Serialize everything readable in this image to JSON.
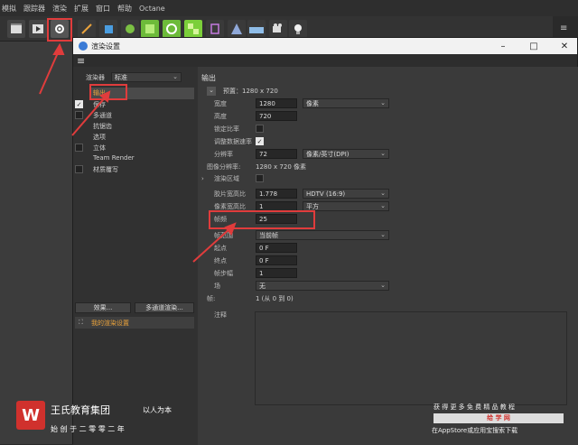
{
  "app_menu": [
    "模拟",
    "跟踪器",
    "渲染",
    "扩展",
    "窗口",
    "帮助",
    "Octane"
  ],
  "window": {
    "title": "渲染设置"
  },
  "left": {
    "renderer_label": "渲染器",
    "renderer_value": "标准",
    "tree": [
      "输出",
      "保存",
      "多通道",
      "抗锯齿",
      "选项",
      "立体",
      "Team Render",
      "材质覆写"
    ],
    "effects_button": "效果...",
    "multipass_button": "多通道渲染...",
    "render_setting_name": "我的渲染设置"
  },
  "output": {
    "section_title": "输出",
    "preset_label": "预置：1280 x 720",
    "width_label": "宽度",
    "width_value": "1280",
    "width_unit": "像素",
    "height_label": "高度",
    "height_value": "720",
    "lock_ratio_label": "锁定比率",
    "adjust_rate_label": "调整数据速率",
    "resolution_label": "分辨率",
    "resolution_value": "72",
    "resolution_unit": "像素/英寸(DPI)",
    "image_res_label": "图像分辨率:",
    "image_res_value": "1280 x 720 像素",
    "render_region_label": "渲染区域",
    "film_aspect_label": "胶片宽高比",
    "film_aspect_value": "1.778",
    "film_aspect_preset": "HDTV (16:9)",
    "pixel_aspect_label": "像素宽高比",
    "pixel_aspect_value": "1",
    "pixel_aspect_preset": "平方",
    "fps_label": "帧频",
    "fps_value": "25",
    "frame_range_label": "帧范围",
    "frame_range_value": "当前帧",
    "start_label": "起点",
    "start_value": "0 F",
    "end_label": "终点",
    "end_value": "0 F",
    "frame_step_label": "帧步幅",
    "frame_step_value": "1",
    "field_label": "场",
    "field_value": "无",
    "frames_label": "帧:",
    "frames_value": "1 (从 0 到 0)",
    "notes_label": "注释"
  },
  "watermark": {
    "company": "王氏教育集团",
    "motto": "以人为本",
    "tagline": "始 创 于 二 零 零 二 年",
    "promo": "获 得 更 多 免 费 精 品 教 程",
    "promo_badge": "给 学 网",
    "promo_store": "在AppStore或应用宝搜索下载"
  },
  "colors": {
    "highlight": "#e03c3c",
    "accent": "#3b7bd6"
  }
}
